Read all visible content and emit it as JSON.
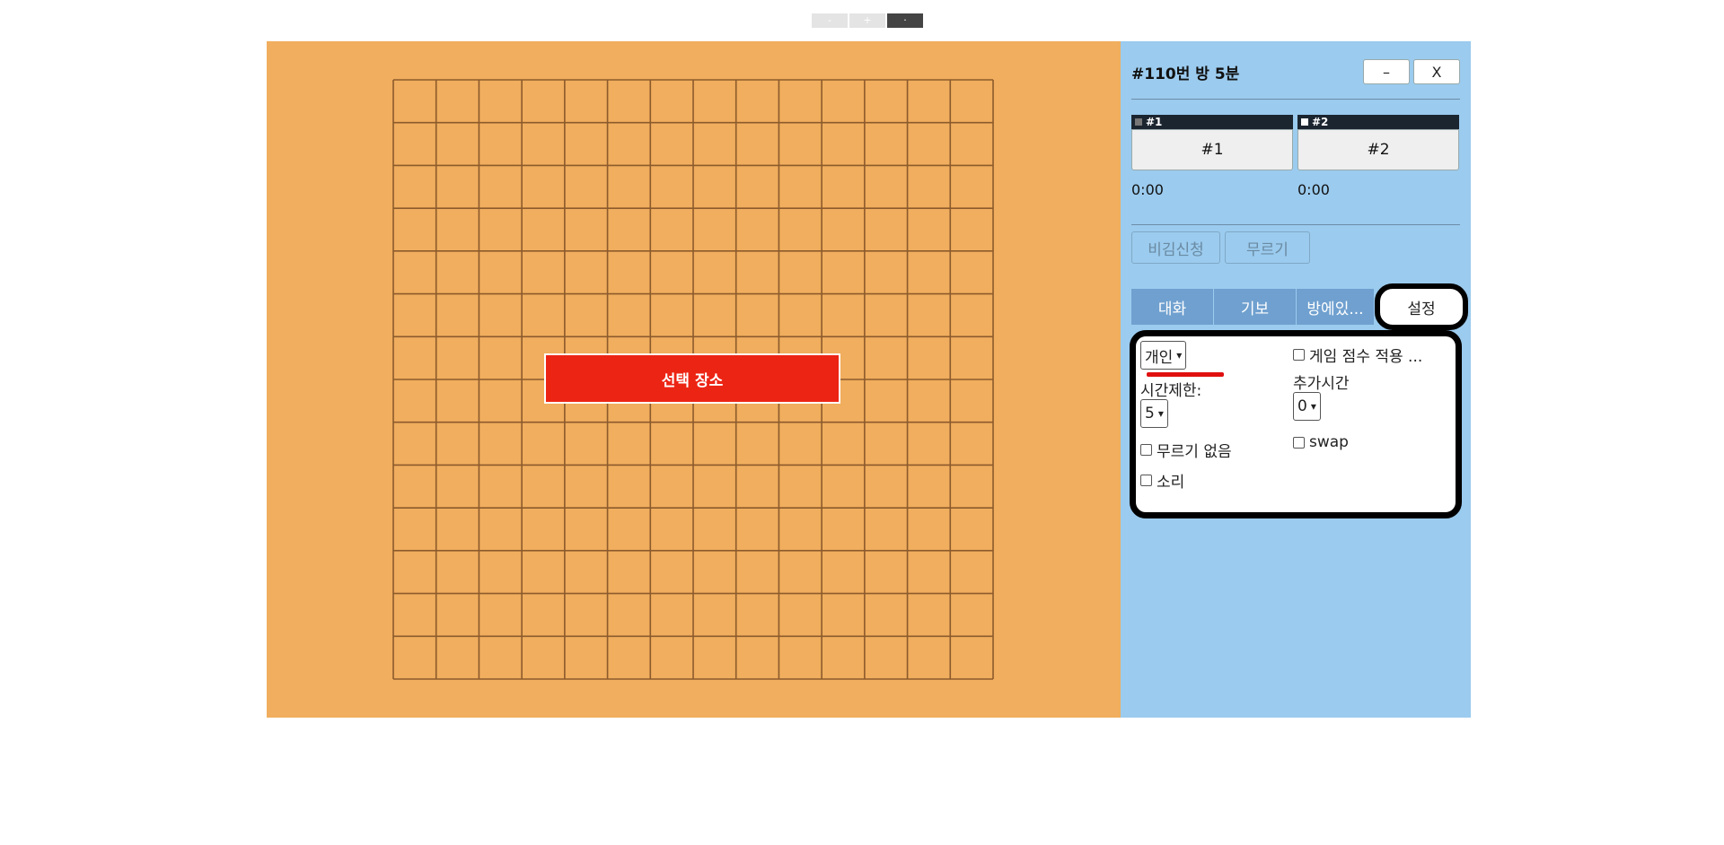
{
  "zoom": {
    "minus": "-",
    "plus": "+",
    "reset": "·"
  },
  "board": {
    "grid_lines": 15,
    "place_button": "선택 장소"
  },
  "panel": {
    "room_title": "#110번 방   5분",
    "minimize": "–",
    "close": "X",
    "players": [
      {
        "tag": "#1",
        "name": "#1",
        "time": "0:00",
        "marker_color": "#777777"
      },
      {
        "tag": "#2",
        "name": "#2",
        "time": "0:00",
        "marker_color": "#ffffff"
      }
    ],
    "actions": {
      "draw": "비김신청",
      "undo": "무르기"
    },
    "tabs": [
      "대화",
      "기보",
      "방에있...",
      "설정"
    ],
    "settings": {
      "mode_select": "개인",
      "score_apply": "게임 점수 적용 ...",
      "time_limit_label": "시간제한:",
      "time_limit_value": "5",
      "extra_time_label": "추가시간",
      "extra_time_value": "0",
      "no_undo": "무르기 없음",
      "swap": "swap",
      "sound": "소리"
    }
  },
  "colors": {
    "board": "#f0ae5e",
    "panel": "#9bcbee",
    "grid": "#8c5a2c",
    "place_button": "#ec2414"
  }
}
